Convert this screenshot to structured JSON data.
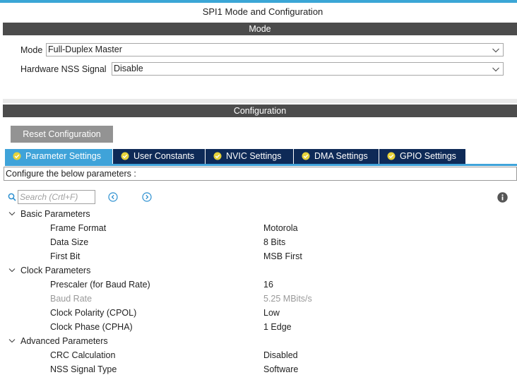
{
  "window": {
    "title": "SPI1 Mode and Configuration"
  },
  "mode_section": {
    "header": "Mode",
    "mode_label": "Mode",
    "mode_value": "Full-Duplex Master",
    "nss_label": "Hardware NSS Signal",
    "nss_value": "Disable"
  },
  "config_section": {
    "header": "Configuration",
    "reset_button": "Reset Configuration",
    "tabs": [
      {
        "label": "Parameter Settings",
        "active": true
      },
      {
        "label": "User Constants",
        "active": false
      },
      {
        "label": "NVIC Settings",
        "active": false
      },
      {
        "label": "DMA Settings",
        "active": false
      },
      {
        "label": "GPIO Settings",
        "active": false
      }
    ],
    "description": "Configure the below parameters :",
    "search_placeholder": "Search (Crtl+F)"
  },
  "groups": {
    "basic": {
      "title": "Basic Parameters",
      "rows": [
        {
          "name": "Frame Format",
          "value": "Motorola"
        },
        {
          "name": "Data Size",
          "value": "8 Bits"
        },
        {
          "name": "First Bit",
          "value": "MSB First"
        }
      ]
    },
    "clock": {
      "title": "Clock Parameters",
      "rows": [
        {
          "name": "Prescaler (for Baud Rate)",
          "value": "16"
        },
        {
          "name": "Baud Rate",
          "value": "5.25 MBits/s"
        },
        {
          "name": "Clock Polarity (CPOL)",
          "value": "Low"
        },
        {
          "name": "Clock Phase (CPHA)",
          "value": "1 Edge"
        }
      ]
    },
    "advanced": {
      "title": "Advanced Parameters",
      "rows": [
        {
          "name": "CRC Calculation",
          "value": "Disabled"
        },
        {
          "name": "NSS Signal Type",
          "value": "Software"
        }
      ]
    }
  },
  "colors": {
    "accent": "#3fa3d9",
    "tab_dark": "#0e2a57",
    "header_bg": "#4c4c4c",
    "check_yellow": "#e6d23a",
    "disabled_text": "#9a9a9a"
  }
}
